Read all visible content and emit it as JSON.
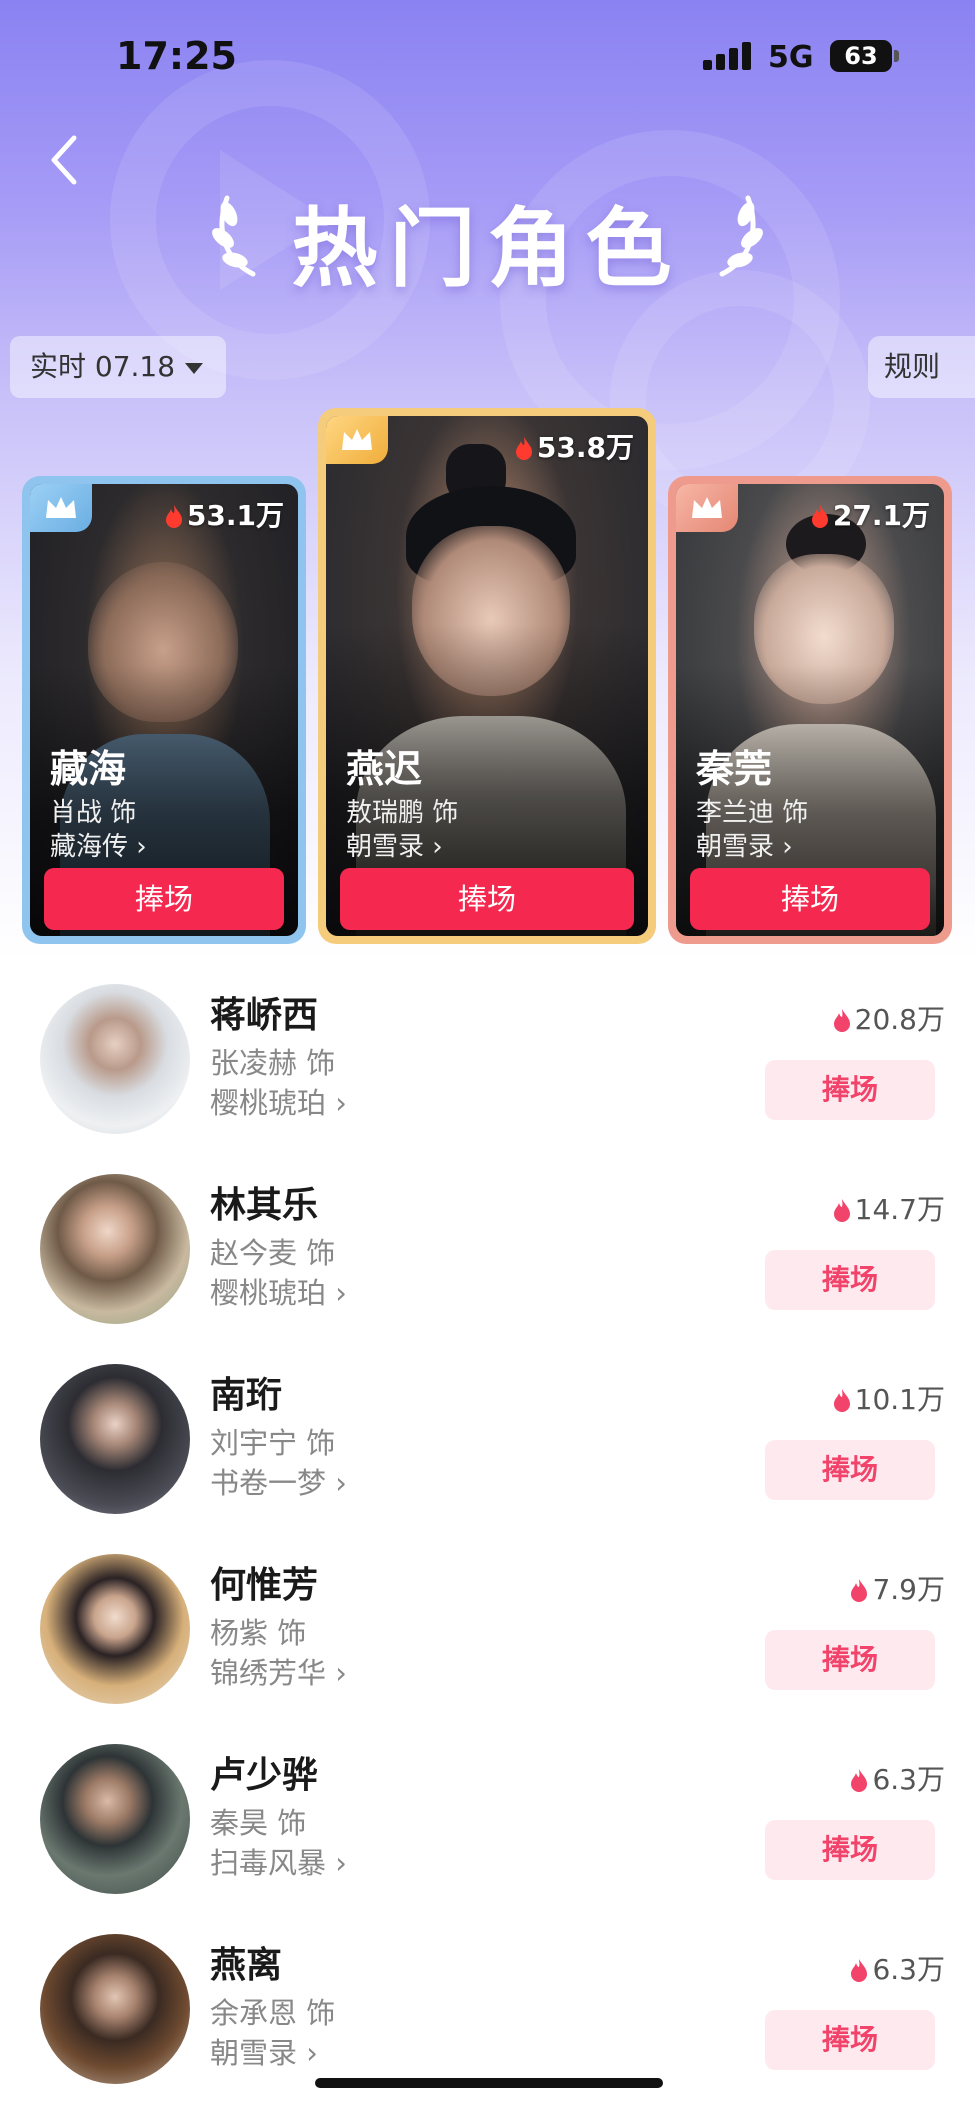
{
  "status_bar": {
    "time": "17:25",
    "network": "5G",
    "battery": "63"
  },
  "header": {
    "title": "热门角色",
    "date_filter": "实时 07.18",
    "rules": "规则"
  },
  "colors": {
    "accent": "#f5284f",
    "button_soft_bg": "#fde9ee",
    "gold": "#f4c063",
    "blue": "#7ab8ea",
    "rose": "#ea8a7c"
  },
  "top3": [
    {
      "rank": "1",
      "name": "燕迟",
      "actor": "敖瑞鹏 饰",
      "drama": "朝雪录 ›",
      "heat": "53.8万",
      "button": "捧场"
    },
    {
      "rank": "2",
      "name": "藏海",
      "actor": "肖战 饰",
      "drama": "藏海传 ›",
      "heat": "53.1万",
      "button": "捧场"
    },
    {
      "rank": "3",
      "name": "秦莞",
      "actor": "李兰迪 饰",
      "drama": "朝雪录 ›",
      "heat": "27.1万",
      "button": "捧场"
    }
  ],
  "list": [
    {
      "name": "蒋峤西",
      "actor": "张凌赫 饰",
      "drama": "樱桃琥珀 ›",
      "heat": "20.8万",
      "button": "捧场"
    },
    {
      "name": "林其乐",
      "actor": "赵今麦 饰",
      "drama": "樱桃琥珀 ›",
      "heat": "14.7万",
      "button": "捧场"
    },
    {
      "name": "南珩",
      "actor": "刘宇宁 饰",
      "drama": "书卷一梦 ›",
      "heat": "10.1万",
      "button": "捧场"
    },
    {
      "name": "何惟芳",
      "actor": "杨紫 饰",
      "drama": "锦绣芳华 ›",
      "heat": "7.9万",
      "button": "捧场"
    },
    {
      "name": "卢少骅",
      "actor": "秦昊 饰",
      "drama": "扫毒风暴 ›",
      "heat": "6.3万",
      "button": "捧场"
    },
    {
      "name": "燕离",
      "actor": "余承恩 饰",
      "drama": "朝雪录 ›",
      "heat": "6.3万",
      "button": "捧场"
    }
  ]
}
